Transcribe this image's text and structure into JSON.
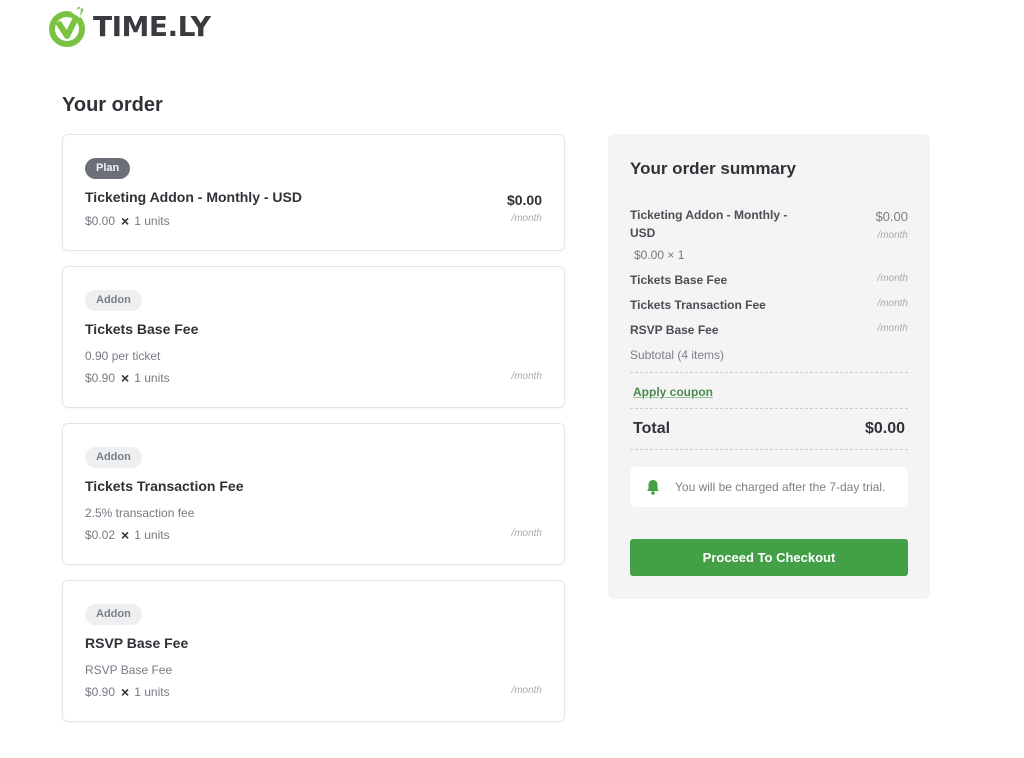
{
  "brand": {
    "name": "TIME.LY",
    "icon": "check-circle-logo-icon",
    "accent_color": "#7cc242"
  },
  "page": {
    "title": "Your order"
  },
  "order_items": [
    {
      "badge": "Plan",
      "title": "Ticketing Addon - Monthly - USD",
      "description": "",
      "unit_price": "$0.00",
      "multiply_icon": "×",
      "quantity": "1 units",
      "price": "$0.00",
      "period": "/month"
    },
    {
      "badge": "Addon",
      "title": "Tickets Base Fee",
      "description": "0.90 per ticket",
      "unit_price": "$0.90",
      "multiply_icon": "×",
      "quantity": "1 units",
      "price": "",
      "period": "/month"
    },
    {
      "badge": "Addon",
      "title": "Tickets Transaction Fee",
      "description": "2.5% transaction fee",
      "unit_price": "$0.02",
      "multiply_icon": "×",
      "quantity": "1 units",
      "price": "",
      "period": "/month"
    },
    {
      "badge": "Addon",
      "title": "RSVP Base Fee",
      "description": "RSVP Base Fee",
      "unit_price": "$0.90",
      "multiply_icon": "×",
      "quantity": "1 units",
      "price": "",
      "period": "/month"
    }
  ],
  "summary": {
    "title": "Your order summary",
    "lines": [
      {
        "name": "Ticketing Addon - Monthly - USD",
        "price": "$0.00",
        "period": "/month",
        "qty": "$0.00 × 1"
      },
      {
        "name": "Tickets Base Fee",
        "price": "",
        "period": "/month"
      },
      {
        "name": "Tickets Transaction Fee",
        "price": "",
        "period": "/month"
      },
      {
        "name": "RSVP Base Fee",
        "price": "",
        "period": "/month"
      }
    ],
    "subtotal_label": "Subtotal (4 items)",
    "coupon_link": "Apply coupon",
    "total_label": "Total",
    "total_value": "$0.00",
    "notice": {
      "icon": "bell-icon",
      "text": "You will be charged after the 7-day trial."
    },
    "checkout_button": "Proceed To Checkout",
    "button_color": "#43a047"
  }
}
